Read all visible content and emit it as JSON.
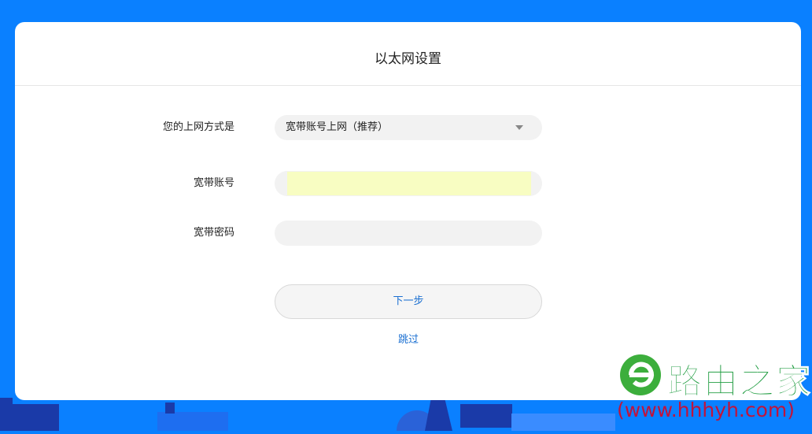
{
  "page": {
    "title": "以太网设置"
  },
  "form": {
    "connection_type": {
      "label": "您的上网方式是",
      "selected": "宽带账号上网（推荐）"
    },
    "account": {
      "label": "宽带账号",
      "value": ""
    },
    "password": {
      "label": "宽带密码",
      "value": ""
    }
  },
  "actions": {
    "next_label": "下一步",
    "skip_label": "跳过"
  },
  "watermark": {
    "brand": "路由之家",
    "url": "(www.hhhyh.com)"
  },
  "colors": {
    "background": "#0a80ff",
    "link": "#1a6fd1",
    "autofill": "#f8fdc2",
    "brand_green": "#1a9a3c",
    "brand_red": "#c0143c"
  }
}
